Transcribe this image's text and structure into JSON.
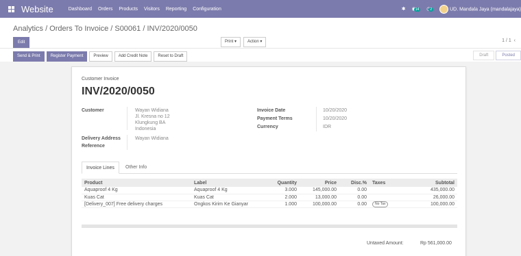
{
  "topbar": {
    "app_name": "Website",
    "menu": [
      "Dashboard",
      "Orders",
      "Products",
      "Visitors",
      "Reporting",
      "Configuration"
    ],
    "chat_badge": "14",
    "activity_badge": "2",
    "user": "UD. Mandala Jaya (mandalajaya)"
  },
  "control_panel": {
    "breadcrumb": "Analytics / Orders To Invoice / S00061 / INV/2020/0050",
    "edit_label": "Edit",
    "print_label": "Print ▾",
    "action_label": "Action ▾",
    "pager": "1 / 1"
  },
  "status_actions": {
    "buttons": [
      "Send & Print",
      "Register Payment",
      "Preview",
      "Add Credit Note",
      "Reset to Draft"
    ],
    "stages": [
      "Draft",
      "Posted"
    ]
  },
  "invoice": {
    "subtitle": "Customer Invoice",
    "number": "INV/2020/0050",
    "customer_label": "Customer",
    "customer_lines": [
      "Wayan Widiana",
      "Jl. Kresna no 12",
      "Klungkung BA",
      "Indonesia"
    ],
    "delivery_label": "Delivery Address",
    "delivery_value": "Wayan Widiana",
    "reference_label": "Reference",
    "invoice_date_label": "Invoice Date",
    "invoice_date": "10/20/2020",
    "payment_terms_label": "Payment Terms",
    "payment_terms": "10/20/2020",
    "currency_label": "Currency",
    "currency": "IDR"
  },
  "tabs": [
    "Invoice Lines",
    "Other Info"
  ],
  "lines": {
    "headers": [
      "Product",
      "Label",
      "Quantity",
      "Price",
      "Disc.%",
      "Taxes",
      "Subtotal"
    ],
    "rows": [
      {
        "product": "Aquaproof 4 Kg",
        "label": "Aquaproof 4 Kg",
        "qty": "3.000",
        "price": "145,000.00",
        "disc": "0.00",
        "tax": "",
        "subtotal": "435,000.00"
      },
      {
        "product": "Kuas Cat",
        "label": "Kuas Cat",
        "qty": "2.000",
        "price": "13,000.00",
        "disc": "0.00",
        "tax": "",
        "subtotal": "26,000.00"
      },
      {
        "product": "[Delivery_007] Free delivery charges",
        "label": "Ongkos Kirim Ke Gianyar",
        "qty": "1.000",
        "price": "100,000.00",
        "disc": "0.00",
        "tax": "No Tax",
        "subtotal": "100,000.00"
      }
    ]
  },
  "totals": {
    "untaxed_label": "Untaxed Amount:",
    "untaxed_value": "Rp 561,000.00"
  }
}
